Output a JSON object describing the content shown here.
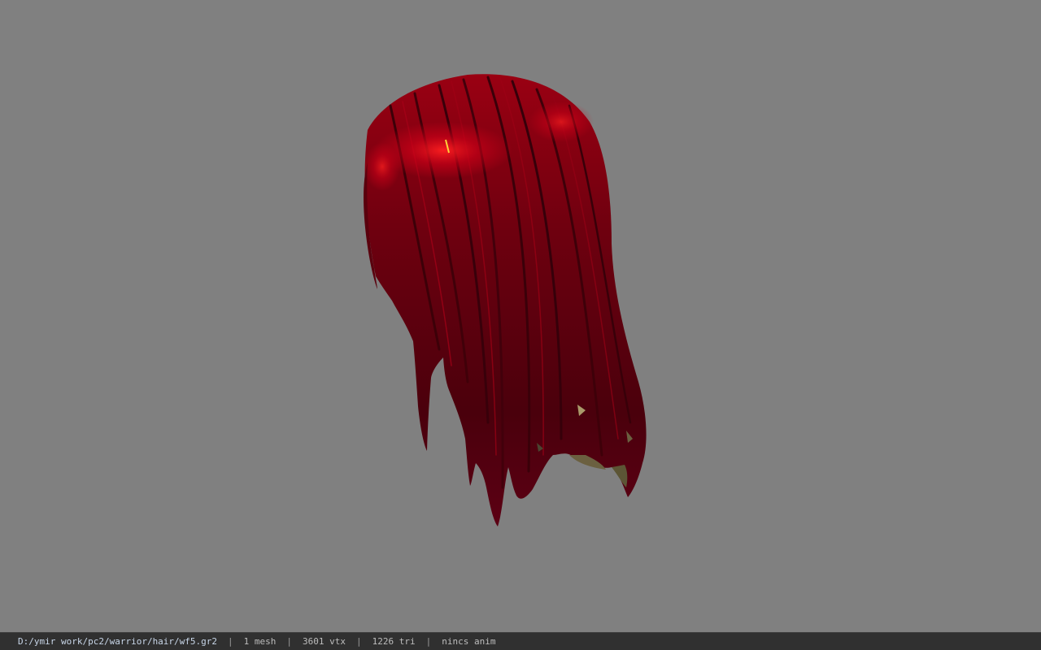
{
  "viewport": {
    "background_color": "#808080",
    "model": {
      "description_icon": "hair-mesh-model",
      "primary_color": "#8a0018",
      "highlight_color": "#e0101e",
      "shadow_color": "#3a0008"
    }
  },
  "status_bar": {
    "file_path": "D:/ymir work/pc2/warrior/hair/wf5.gr2",
    "separator": "|",
    "mesh_count": "1 mesh",
    "vertex_count": "3601 vtx",
    "triangle_count": "1226 tri",
    "animation": "nincs anim"
  }
}
